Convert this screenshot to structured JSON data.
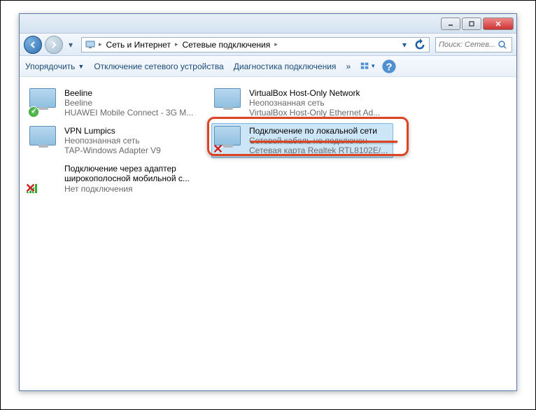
{
  "breadcrumb": {
    "item1": "Сеть и Интернет",
    "item2": "Сетевые подключения"
  },
  "search": {
    "placeholder": "Поиск: Сетев..."
  },
  "toolbar": {
    "organize": "Упорядочить",
    "disable": "Отключение сетевого устройства",
    "diagnose": "Диагностика подключения",
    "more": "»"
  },
  "connections": [
    {
      "name": "Beeline",
      "status": "Beeline",
      "device": "HUAWEI Mobile Connect - 3G M...",
      "badge": "check"
    },
    {
      "name": "VirtualBox Host-Only Network",
      "status": "Неопознанная сеть",
      "device": "VirtualBox Host-Only Ethernet Ad...",
      "badge": "none"
    },
    {
      "name": "VPN Lumpics",
      "status": "Неопознанная сеть",
      "device": "TAP-Windows Adapter V9",
      "badge": "none"
    },
    {
      "name": "Подключение по локальной сети",
      "status": "Сетевой кабель не подключен",
      "device": "Сетевая карта Realtek RTL8102E/...",
      "badge": "cross",
      "selected": true
    },
    {
      "name": "Подключение через адаптер широкополосной мобильной с...",
      "status": "Нет подключения",
      "device": "",
      "badge": "signal-cross"
    }
  ]
}
